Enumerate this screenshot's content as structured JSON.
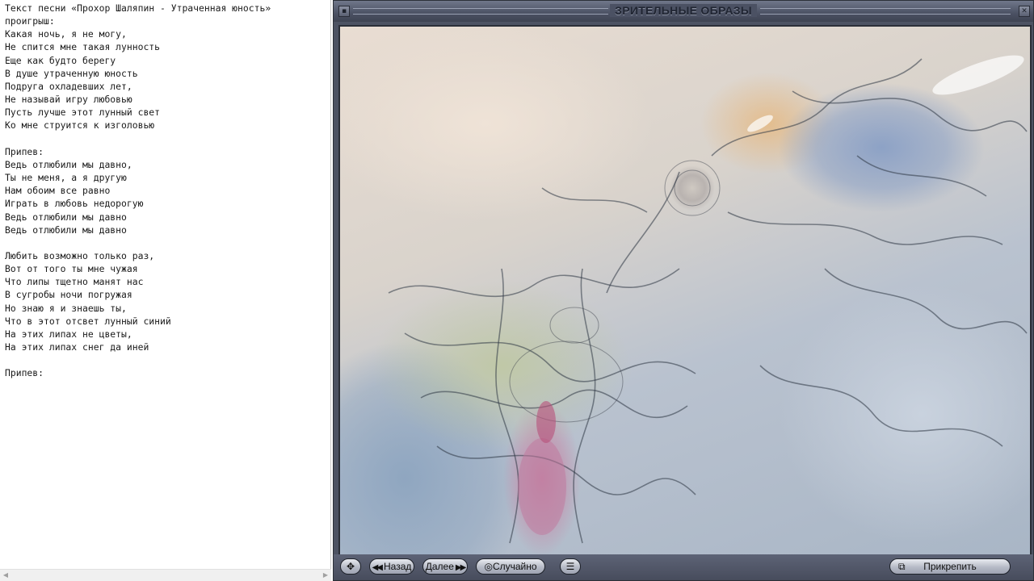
{
  "document": {
    "lines": [
      "Текст песни «Прохор Шаляпин - Утраченная юность»",
      "проигрыш:",
      "Какая ночь, я не могу,",
      "Не спится мне такая лунность",
      "Еще как будто берегу",
      "В душе утраченную юность",
      "Подруга охладевших лет,",
      "Не называй игру любовью",
      "Пусть лучше этот лунный свет",
      "Ко мне струится к изголовью",
      "",
      "Припев:",
      "Ведь отлюбили мы давно,",
      "Ты не меня, а я другую",
      "Нам обоим все равно",
      "Играть в любовь недорогую",
      "Ведь отлюбили мы давно",
      "Ведь отлюбили мы давно",
      "",
      "Любить возможно только раз,",
      "Вот от того ты мне чужая",
      "Что липы тщетно манят нас",
      "В сугробы ночи погружая",
      "Но знаю я и знаешь ты,",
      "Что в этот отсвет лунный синий",
      "На этих липах не цветы,",
      "На этих липах снег да иней",
      "",
      "Припев:"
    ]
  },
  "visualizer": {
    "title": "ЗРИТЕЛЬНЫЕ ОБРАЗЫ",
    "controls": {
      "back_label": "Назад",
      "next_label": "Далее",
      "random_label": "Случайно",
      "pin_label": "Прикрепить"
    }
  },
  "colors": {
    "window_frame": "#4d5363",
    "button_face": "#c9ccd6"
  }
}
